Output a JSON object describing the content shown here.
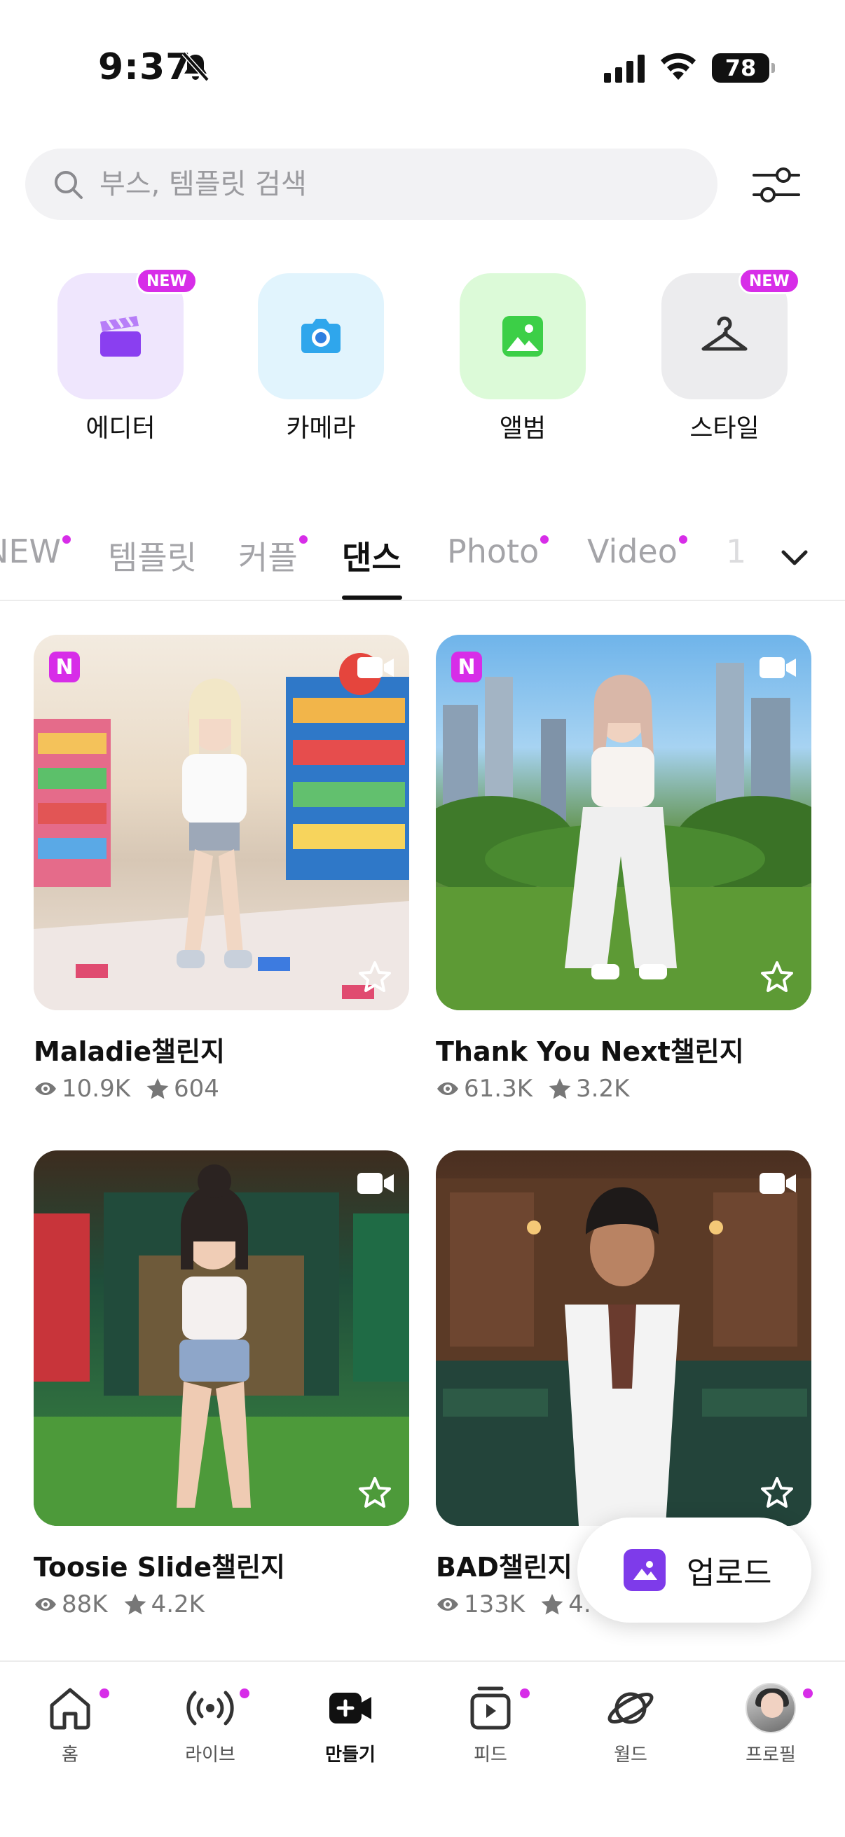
{
  "status_bar": {
    "time": "9:37",
    "battery": "78"
  },
  "search": {
    "placeholder": "부스, 템플릿 검색"
  },
  "quick_actions": [
    {
      "label": "에디터",
      "badge": "NEW",
      "icon": "clapperboard-icon"
    },
    {
      "label": "카메라",
      "badge": "",
      "icon": "camera-icon"
    },
    {
      "label": "앨범",
      "badge": "",
      "icon": "image-icon"
    },
    {
      "label": "스타일",
      "badge": "NEW",
      "icon": "hanger-icon"
    }
  ],
  "tabs": [
    {
      "label": "NEW",
      "dot": true
    },
    {
      "label": "템플릿",
      "dot": false
    },
    {
      "label": "커플",
      "dot": true
    },
    {
      "label": "댄스",
      "dot": false,
      "active": true
    },
    {
      "label": "Photo",
      "dot": true
    },
    {
      "label": "Video",
      "dot": true
    },
    {
      "label": "1",
      "dot": false
    }
  ],
  "cards": [
    {
      "title": "Maladie챌린지",
      "views": "10.9K",
      "stars": "604",
      "new_badge": "N"
    },
    {
      "title": "Thank You Next챌린지",
      "views": "61.3K",
      "stars": "3.2K",
      "new_badge": "N"
    },
    {
      "title": "Toosie Slide챌린지",
      "views": "88K",
      "stars": "4.2K",
      "new_badge": ""
    },
    {
      "title": "BAD챌린지",
      "views": "133K",
      "stars": "4.",
      "new_badge": ""
    }
  ],
  "upload_button": {
    "label": "업로드"
  },
  "bottom_nav": [
    {
      "label": "홈",
      "icon": "home-icon",
      "dot": true
    },
    {
      "label": "라이브",
      "icon": "live-broadcast-icon",
      "dot": true
    },
    {
      "label": "만들기",
      "icon": "create-video-icon",
      "dot": false,
      "active": true
    },
    {
      "label": "피드",
      "icon": "feed-play-icon",
      "dot": true
    },
    {
      "label": "월드",
      "icon": "planet-icon",
      "dot": false
    },
    {
      "label": "프로필",
      "icon": "avatar",
      "dot": true
    }
  ],
  "colors": {
    "accent": "#d72de8",
    "upload_icon": "#7e3bea"
  }
}
